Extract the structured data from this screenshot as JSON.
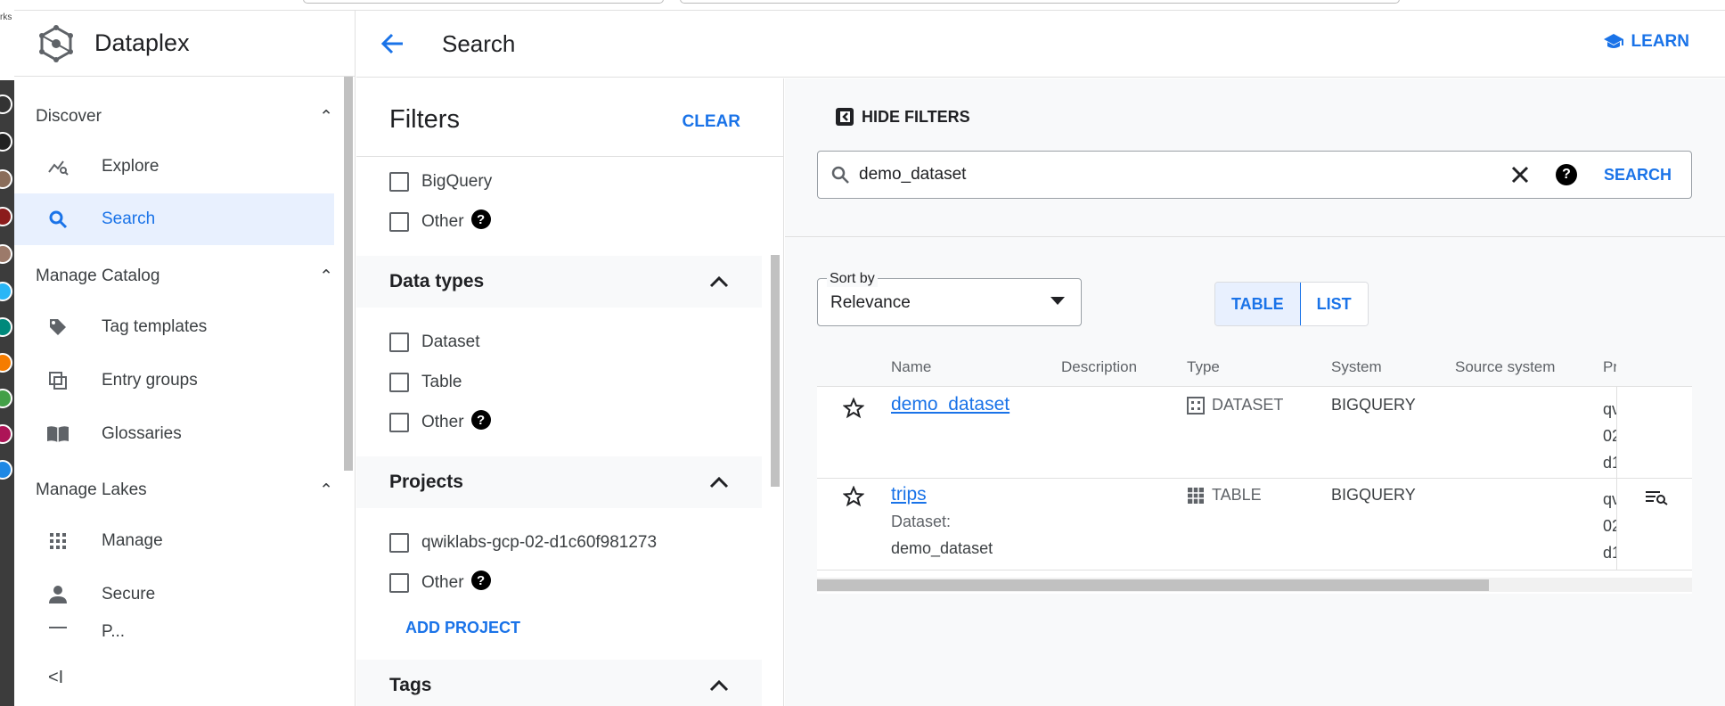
{
  "app": {
    "name": "Dataplex",
    "page_title": "Search",
    "learn_label": "LEARN"
  },
  "browser": {
    "edge_label": "rks"
  },
  "sidebar": {
    "sections": [
      {
        "label": "Discover",
        "items": [
          {
            "label": "Explore",
            "icon": "explore-icon"
          },
          {
            "label": "Search",
            "icon": "search-icon",
            "active": true
          }
        ]
      },
      {
        "label": "Manage Catalog",
        "items": [
          {
            "label": "Tag templates",
            "icon": "tag-icon"
          },
          {
            "label": "Entry groups",
            "icon": "entry-groups-icon"
          },
          {
            "label": "Glossaries",
            "icon": "book-icon"
          }
        ]
      },
      {
        "label": "Manage Lakes",
        "items": [
          {
            "label": "Manage",
            "icon": "grid-icon"
          },
          {
            "label": "Secure",
            "icon": "person-icon"
          },
          {
            "label": "P...",
            "icon": "list-icon"
          }
        ]
      }
    ],
    "collapse_label": "<I"
  },
  "filters": {
    "title": "Filters",
    "clear_label": "CLEAR",
    "systems": [
      {
        "label": "BigQuery"
      },
      {
        "label": "Other",
        "help": "?"
      }
    ],
    "data_types": {
      "label": "Data types",
      "options": [
        {
          "label": "Dataset"
        },
        {
          "label": "Table"
        },
        {
          "label": "Other",
          "help": "?"
        }
      ]
    },
    "projects": {
      "label": "Projects",
      "options": [
        {
          "label": "qwiklabs-gcp-02-d1c60f981273"
        },
        {
          "label": "Other",
          "help": "?"
        }
      ],
      "add_label": "ADD PROJECT"
    },
    "tags": {
      "label": "Tags"
    }
  },
  "results": {
    "hide_filters_label": "HIDE FILTERS",
    "search": {
      "value": "demo_dataset",
      "button_label": "SEARCH",
      "help": "?"
    },
    "sort": {
      "label": "Sort by",
      "value": "Relevance"
    },
    "view_toggle": {
      "table_label": "TABLE",
      "list_label": "LIST",
      "active": "TABLE"
    },
    "table": {
      "columns": [
        "Name",
        "Description",
        "Type",
        "System",
        "Source system",
        "Pr"
      ],
      "rows": [
        {
          "name": "demo_dataset",
          "sub_label": "",
          "sub_value": "",
          "description": "",
          "type": "DATASET",
          "system": "BIGQUERY",
          "source_system": "",
          "project_lines": [
            "qv",
            "02",
            "d1"
          ]
        },
        {
          "name": "trips",
          "sub_label": "Dataset:",
          "sub_value": "demo_dataset",
          "description": "",
          "type": "TABLE",
          "system": "BIGQUERY",
          "source_system": "",
          "project_lines": [
            "qv",
            "02",
            "d1"
          ]
        }
      ]
    }
  },
  "colors": {
    "accent": "#1a73e8",
    "active_bg": "#e8f0fe",
    "panel_bg": "#f8f9fa"
  }
}
